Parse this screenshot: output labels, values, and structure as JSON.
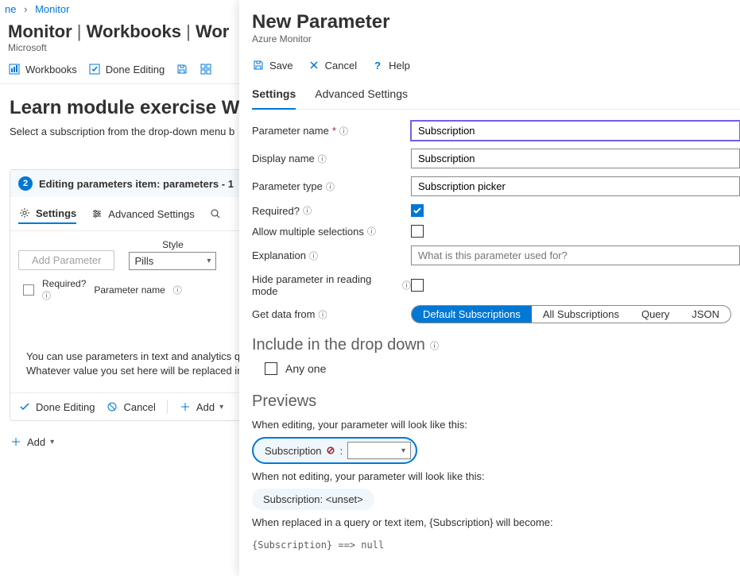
{
  "breadcrumb": {
    "item1": "ne",
    "item2": "Monitor"
  },
  "page": {
    "title_service": "Monitor",
    "title_sep": " | ",
    "title_area": "Workbooks",
    "title_sep2": " | ",
    "title_item": "Wor",
    "subtitle": "Microsoft"
  },
  "toolbar": {
    "workbooks": "Workbooks",
    "done_editing": "Done Editing"
  },
  "doc": {
    "heading": "Learn module exercise W",
    "subheading": "Select a subscription from the drop-down menu b"
  },
  "step": {
    "number": "2",
    "title": "Editing parameters item: parameters - 1",
    "tab_settings": "Settings",
    "tab_advanced": "Advanced Settings",
    "add_parameter": "Add Parameter",
    "style_label": "Style",
    "style_value": "Pills",
    "col_required": "Required?",
    "col_name": "Parameter name",
    "hint1": "You can use parameters in text and analytics qu",
    "hint2": "Whatever value you set here will be replaced in",
    "foot_done": "Done Editing",
    "foot_cancel": "Cancel",
    "foot_add": "Add"
  },
  "bottom": {
    "add": "Add"
  },
  "panel": {
    "title": "New Parameter",
    "subtitle": "Azure Monitor",
    "save": "Save",
    "cancel": "Cancel",
    "help": "Help",
    "tab_settings": "Settings",
    "tab_advanced": "Advanced Settings",
    "labels": {
      "name": "Parameter name",
      "display": "Display name",
      "type": "Parameter type",
      "required": "Required?",
      "multi": "Allow multiple selections",
      "explanation": "Explanation",
      "hide": "Hide parameter in reading mode",
      "getdata": "Get data from"
    },
    "values": {
      "name": "Subscription",
      "display": "Subscription",
      "type": "Subscription picker",
      "explanation_placeholder": "What is this parameter used for?"
    },
    "seg": {
      "default": "Default Subscriptions",
      "all": "All Subscriptions",
      "query": "Query",
      "json": "JSON"
    },
    "include": {
      "heading": "Include in the drop down",
      "anyone": "Any one"
    },
    "previews": {
      "heading": "Previews",
      "editing_text": "When editing, your parameter will look like this:",
      "pill_label": "Subscription",
      "notediting_text": "When not editing, your parameter will look like this:",
      "static_pill": "Subscription: <unset>",
      "replace_text": "When replaced in a query or text item, {Subscription} will become:",
      "code": "{Subscription} ==>  null"
    }
  }
}
